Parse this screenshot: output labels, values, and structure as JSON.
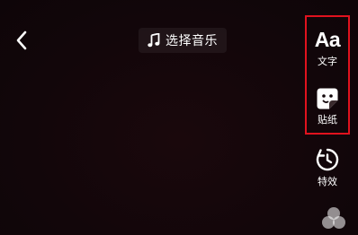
{
  "topbar": {
    "back_icon": "chevron-left-icon",
    "music_icon": "music-note-icon",
    "music_label": "选择音乐"
  },
  "toolbar": {
    "items": [
      {
        "icon_text": "Aa",
        "label": "文字",
        "icon": "text-icon"
      },
      {
        "label": "贴纸",
        "icon": "sticker-icon"
      },
      {
        "label": "特效",
        "icon": "effects-timer-icon"
      },
      {
        "icon": "filter-circles-icon"
      }
    ]
  },
  "colors": {
    "background": "#12060a",
    "highlight": "#e0121e",
    "foreground": "#ffffff"
  }
}
